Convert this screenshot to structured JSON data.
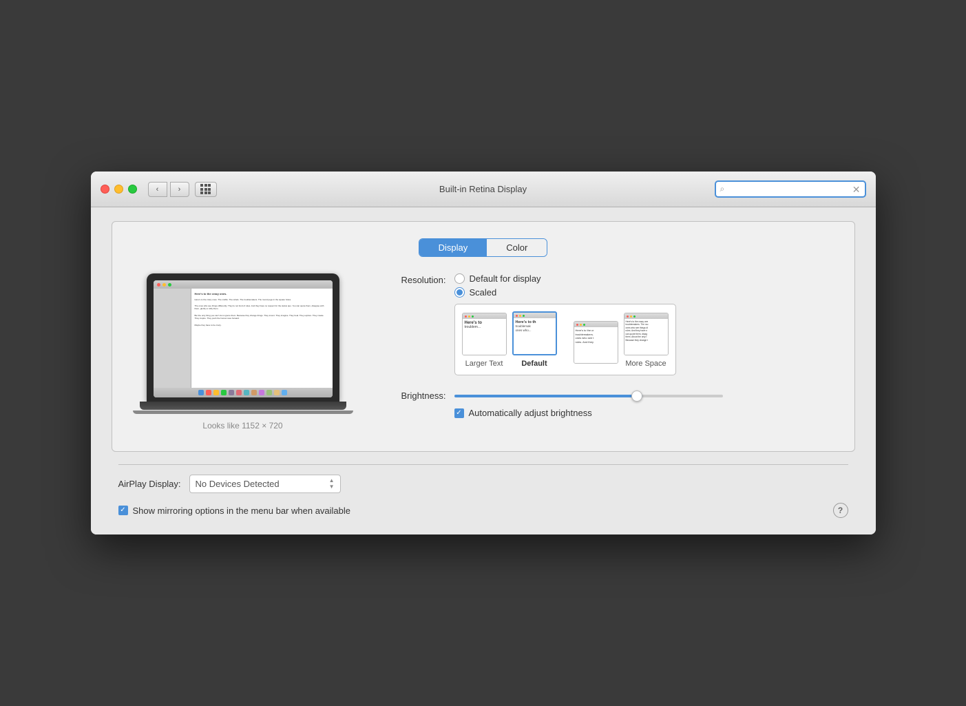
{
  "window": {
    "title": "Built-in Retina Display"
  },
  "titlebar": {
    "back_label": "‹",
    "forward_label": "›"
  },
  "search": {
    "placeholder": ""
  },
  "tabs": {
    "display_label": "Display",
    "color_label": "Color"
  },
  "laptop": {
    "preview_text": "Here's to the crazy ones. The misfits. The rebels. The troublemakers. The round pegs in the square holes.",
    "resolution_label": "Looks like 1152 × 720"
  },
  "resolution": {
    "label": "Resolution:",
    "option1": "Default for display",
    "option2": "Scaled"
  },
  "scale_options": [
    {
      "label": "Larger Text",
      "bold": false
    },
    {
      "label": "Default",
      "bold": true
    },
    {
      "label": "",
      "bold": false
    },
    {
      "label": "More Space",
      "bold": false
    }
  ],
  "brightness": {
    "label": "Brightness:",
    "value": 70
  },
  "auto_brightness": {
    "label": "Automatically adjust brightness",
    "checked": true
  },
  "airplay": {
    "label": "AirPlay Display:",
    "dropdown_value": "No Devices Detected"
  },
  "mirroring": {
    "label": "Show mirroring options in the menu bar when available",
    "checked": true
  },
  "help": {
    "label": "?"
  }
}
